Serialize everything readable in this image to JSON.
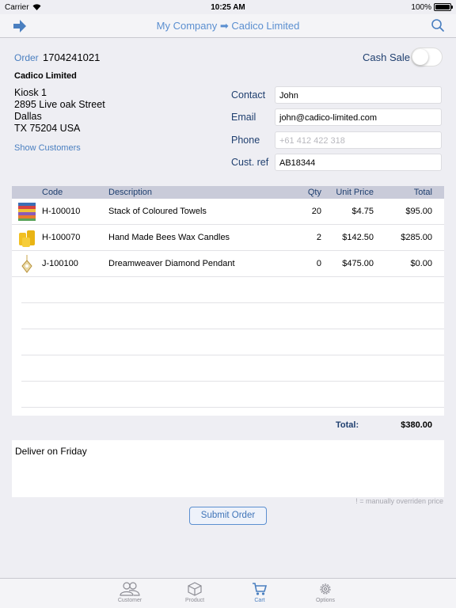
{
  "status": {
    "carrier": "Carrier",
    "time": "10:25 AM",
    "battery": "100%"
  },
  "nav": {
    "title": "My Company ➡ Cadico Limited"
  },
  "order": {
    "label": "Order",
    "number": "1704241021",
    "cash_sale_label": "Cash Sale",
    "cash_sale_on": false
  },
  "customer": {
    "name": "Cadico Limited",
    "address": [
      "Kiosk 1",
      "2895 Live oak Street",
      "Dallas",
      "TX 75204 USA"
    ],
    "show_customers": "Show Customers"
  },
  "fields": {
    "contact": {
      "label": "Contact",
      "value": "John"
    },
    "email": {
      "label": "Email",
      "value": "john@cadico-limited.com"
    },
    "phone": {
      "label": "Phone",
      "placeholder": "+61 412 422 318"
    },
    "custref": {
      "label": "Cust. ref",
      "value": "AB18344"
    }
  },
  "table": {
    "headers": {
      "code": "Code",
      "description": "Description",
      "qty": "Qty",
      "unit_price": "Unit Price",
      "total": "Total"
    },
    "rows": [
      {
        "code": "H-100010",
        "description": "Stack of Coloured Towels",
        "qty": "20",
        "unit_price": "$4.75",
        "total": "$95.00",
        "icon": "towels-icon"
      },
      {
        "code": "H-100070",
        "description": "Hand Made Bees Wax Candles",
        "qty": "2",
        "unit_price": "$142.50",
        "total": "$285.00",
        "icon": "candles-icon"
      },
      {
        "code": "J-100100",
        "description": "Dreamweaver Diamond Pendant",
        "qty": "0",
        "unit_price": "$475.00",
        "total": "$0.00",
        "icon": "pendant-icon"
      }
    ]
  },
  "totals": {
    "label": "Total:",
    "value": "$380.00"
  },
  "notes": "Deliver on Friday",
  "override_note": "! = manually overriden price",
  "submit_label": "Submit Order",
  "tabs": [
    {
      "label": "Customer",
      "icon": "customer-icon",
      "active": false
    },
    {
      "label": "Product",
      "icon": "product-icon",
      "active": false
    },
    {
      "label": "Cart",
      "icon": "cart-icon",
      "active": true
    },
    {
      "label": "Options",
      "icon": "gear-icon",
      "active": false
    }
  ],
  "colors": {
    "accent": "#4a7fc0",
    "label": "#1f3f6f",
    "header_bg": "#c9cbd9",
    "page_bg": "#eeeef3"
  }
}
